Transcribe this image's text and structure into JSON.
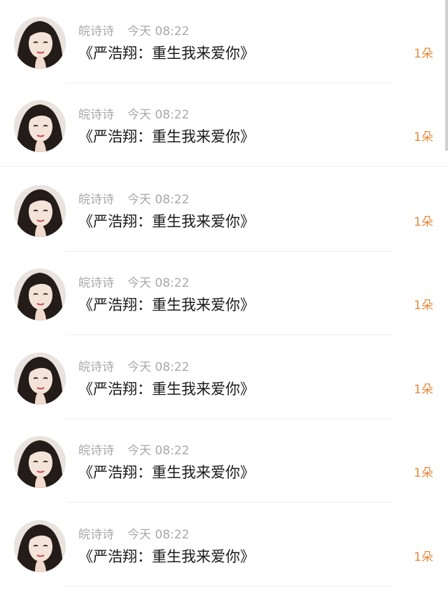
{
  "rows": [
    {
      "user": "皖诗诗",
      "time": "今天 08:22",
      "title": "《严浩翔：重生我来爱你》",
      "count": "1朵"
    },
    {
      "user": "皖诗诗",
      "time": "今天 08:22",
      "title": "《严浩翔：重生我来爱你》",
      "count": "1朵"
    },
    {
      "user": "皖诗诗",
      "time": "今天 08:22",
      "title": "《严浩翔：重生我来爱你》",
      "count": "1朵"
    },
    {
      "user": "皖诗诗",
      "time": "今天 08:22",
      "title": "《严浩翔：重生我来爱你》",
      "count": "1朵"
    },
    {
      "user": "皖诗诗",
      "time": "今天 08:22",
      "title": "《严浩翔：重生我来爱你》",
      "count": "1朵"
    },
    {
      "user": "皖诗诗",
      "time": "今天 08:22",
      "title": "《严浩翔：重生我来爱你》",
      "count": "1朵"
    },
    {
      "user": "皖诗诗",
      "time": "今天 08:22",
      "title": "《严浩翔：重生我来爱你》",
      "count": "1朵"
    }
  ],
  "colors": {
    "meta": "#a8a8a8",
    "title": "#1a1a1a",
    "count": "#e68a3c",
    "divider": "#efefef"
  }
}
